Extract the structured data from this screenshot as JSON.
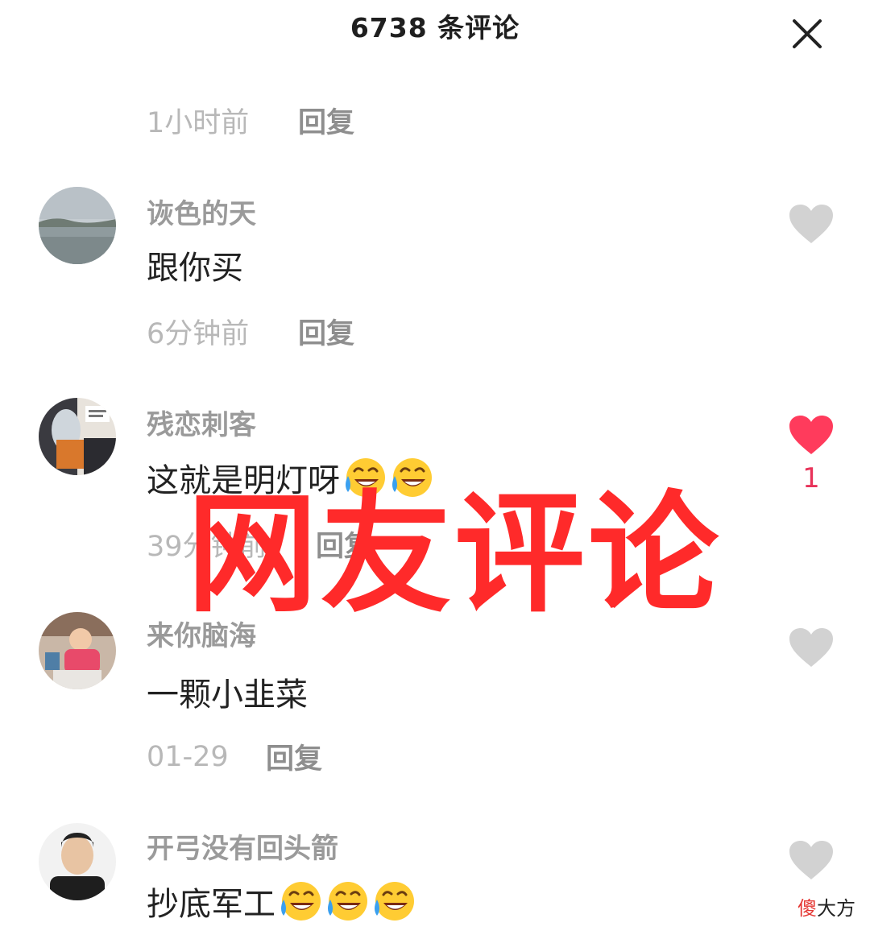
{
  "header": {
    "title": "6738 条评论"
  },
  "icons": {
    "close": "close-icon",
    "like": "heart-icon",
    "emoji": "laughing-crying-emoji"
  },
  "colors": {
    "liked": "#ff3b5c",
    "unliked": "#d2d2d2",
    "overlay": "#ff2a2a"
  },
  "top_meta": {
    "time": "1小时前",
    "reply": "回复"
  },
  "comments": [
    {
      "user": "诙色的天",
      "text": "跟你买",
      "emoji_count": 0,
      "time": "6分钟前",
      "reply": "回复",
      "liked": false,
      "likes": ""
    },
    {
      "user": "残恋刺客",
      "text": "这就是明灯呀",
      "emoji_count": 2,
      "time": "39分钟前",
      "reply": "回复",
      "liked": true,
      "likes": "1"
    },
    {
      "user": "来你脑海",
      "text": "一颗小韭菜",
      "emoji_count": 0,
      "time": "01-29",
      "reply": "回复",
      "liked": false,
      "likes": ""
    },
    {
      "user": "开弓没有回头箭",
      "text": "抄底军工",
      "emoji_count": 3,
      "time": "",
      "reply": "",
      "liked": false,
      "likes": ""
    }
  ],
  "overlay": {
    "text": "网友评论"
  },
  "signature": {
    "first": "傻",
    "rest": "大方"
  }
}
